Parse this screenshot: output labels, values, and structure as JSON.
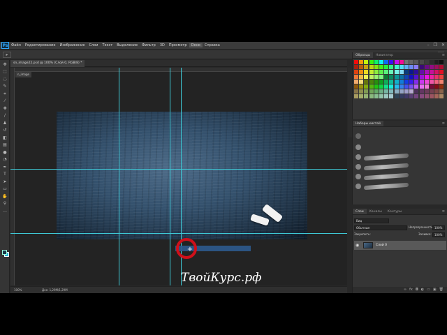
{
  "app": {
    "logo": "Ps",
    "menu": [
      "Файл",
      "Редактирование",
      "Изображение",
      "Слои",
      "Текст",
      "Выделение",
      "Фильтр",
      "3D",
      "Просмотр",
      "Окно",
      "Справка"
    ],
    "active_menu_index": 9,
    "window_controls": [
      "–",
      "❐",
      "✕"
    ]
  },
  "document": {
    "tab_title": "sn_image22.psd @ 100% (Слой 0, RGB/8) *",
    "layer_label": "n_image"
  },
  "status": {
    "zoom": "100%",
    "doc_info": "Док: 1,29M/1,29M"
  },
  "watermark": "ТвойКурс.рф",
  "panels": {
    "swatches_tabs": [
      "Образцы",
      "Навигатор"
    ],
    "brush_presets_title": "Наборы кистей",
    "layers_tabs": [
      "Слои",
      "Каналы",
      "Контуры"
    ],
    "layers_kind": "Вид",
    "blend_mode": "Обычные",
    "opacity_label": "Непрозрачность:",
    "opacity_value": "100%",
    "lock_label": "Закрепить:",
    "fill_label": "Заливка:",
    "fill_value": "100%",
    "layer_name": "Слой 0"
  },
  "colors": {
    "accent": "#31a8ff",
    "guide": "#3ec9d6",
    "marker": "#d0101a",
    "selection": "#2d5a8e"
  },
  "icons": {
    "tools": [
      "move-tool-icon",
      "marquee-tool-icon",
      "lasso-tool-icon",
      "quick-select-icon",
      "crop-icon",
      "eyedropper-icon",
      "healing-brush-icon",
      "brush-icon",
      "clone-stamp-icon",
      "history-brush-icon",
      "eraser-icon",
      "gradient-icon",
      "blur-icon",
      "dodge-icon",
      "pen-icon",
      "type-icon",
      "path-select-icon",
      "rectangle-icon",
      "hand-icon",
      "zoom-icon",
      "more-tools-icon"
    ]
  }
}
